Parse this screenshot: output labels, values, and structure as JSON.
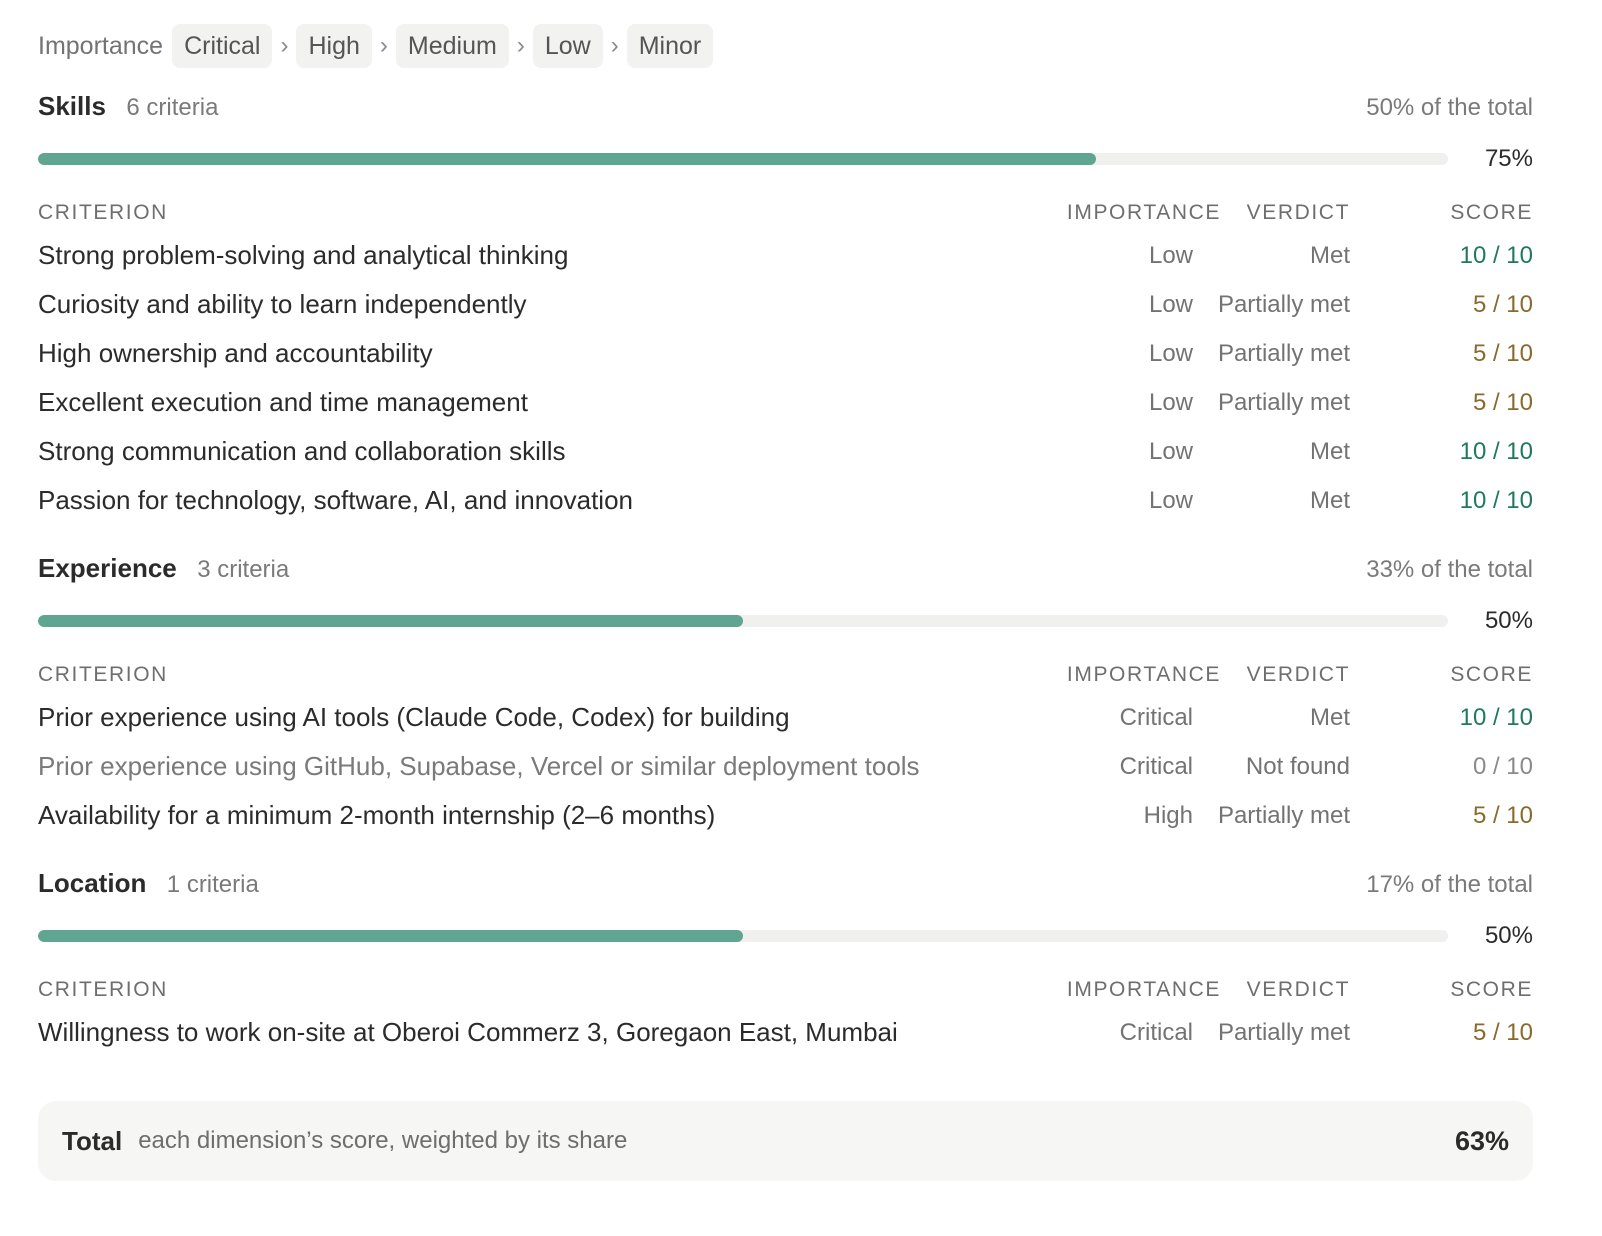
{
  "legend": {
    "label": "Importance",
    "levels": [
      "Critical",
      "High",
      "Medium",
      "Low",
      "Minor"
    ],
    "separator": "›"
  },
  "columns": {
    "criterion": "CRITERION",
    "importance": "IMPORTANCE",
    "verdict": "VERDICT",
    "score": "SCORE"
  },
  "colors": {
    "bar_fill": "#5fa590",
    "score_full": "#1f7a5c",
    "score_partial": "#8a6a2c",
    "score_zero": "#8a8a8a"
  },
  "sections": [
    {
      "title": "Skills",
      "count": "6 criteria",
      "share": "50% of the total",
      "progress": 0.75,
      "progress_label": "75%",
      "rows": [
        {
          "criterion": "Strong problem-solving and analytical thinking",
          "importance": "Low",
          "verdict": "Met",
          "score": "10 / 10",
          "tone": "full"
        },
        {
          "criterion": "Curiosity and ability to learn independently",
          "importance": "Low",
          "verdict": "Partially met",
          "score": "5 / 10",
          "tone": "half"
        },
        {
          "criterion": "High ownership and accountability",
          "importance": "Low",
          "verdict": "Partially met",
          "score": "5 / 10",
          "tone": "half"
        },
        {
          "criterion": "Excellent execution and time management",
          "importance": "Low",
          "verdict": "Partially met",
          "score": "5 / 10",
          "tone": "half"
        },
        {
          "criterion": "Strong communication and collaboration skills",
          "importance": "Low",
          "verdict": "Met",
          "score": "10 / 10",
          "tone": "full"
        },
        {
          "criterion": "Passion for technology, software, AI, and innovation",
          "importance": "Low",
          "verdict": "Met",
          "score": "10 / 10",
          "tone": "full"
        }
      ]
    },
    {
      "title": "Experience",
      "count": "3 criteria",
      "share": "33% of the total",
      "progress": 0.5,
      "progress_label": "50%",
      "rows": [
        {
          "criterion": "Prior experience using AI tools (Claude Code, Codex) for building",
          "importance": "Critical",
          "verdict": "Met",
          "score": "10 / 10",
          "tone": "full"
        },
        {
          "criterion": "Prior experience using GitHub, Supabase, Vercel or similar deployment tools",
          "importance": "Critical",
          "verdict": "Not found",
          "score": "0 / 10",
          "tone": "zero"
        },
        {
          "criterion": "Availability for a minimum 2-month internship (2–6 months)",
          "importance": "High",
          "verdict": "Partially met",
          "score": "5 / 10",
          "tone": "half"
        }
      ]
    },
    {
      "title": "Location",
      "count": "1 criteria",
      "share": "17% of the total",
      "progress": 0.5,
      "progress_label": "50%",
      "rows": [
        {
          "criterion": "Willingness to work on-site at Oberoi Commerz 3, Goregaon East, Mumbai",
          "importance": "Critical",
          "verdict": "Partially met",
          "score": "5 / 10",
          "tone": "half"
        }
      ]
    }
  ],
  "total": {
    "label": "Total",
    "description": "each dimension’s score, weighted by its share",
    "value": "63%"
  }
}
